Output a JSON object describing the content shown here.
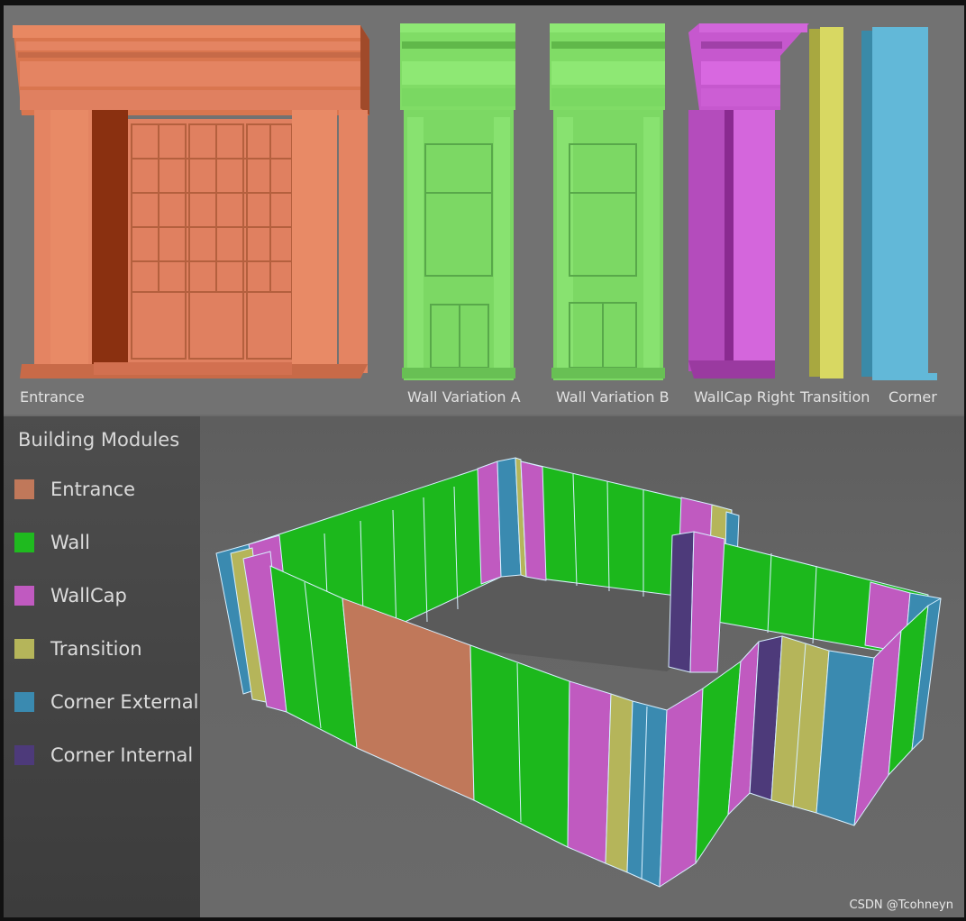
{
  "modules": {
    "entrance_label": "Entrance",
    "wall_a_label": "Wall Variation A",
    "wall_b_label": "Wall Variation B",
    "wallcap_label": "WallCap Right",
    "transition_label": "Transition",
    "corner_label": "Corner"
  },
  "legend": {
    "title": "Building Modules",
    "items": [
      {
        "label": "Entrance",
        "color": "#c0785a"
      },
      {
        "label": "Wall",
        "color": "#1fba1f"
      },
      {
        "label": "WallCap",
        "color": "#c05ac0"
      },
      {
        "label": "Transition",
        "color": "#b5b55a"
      },
      {
        "label": "Corner External",
        "color": "#3a8ab0"
      },
      {
        "label": "Corner Internal",
        "color": "#4d3a7a"
      }
    ]
  },
  "colors": {
    "entrance": "#e0825e",
    "wall": "#7ee06a",
    "wallcap": "#d060d8",
    "transition": "#d8d860",
    "corner": "#60b8d8"
  },
  "watermark": "CSDN @Tcohneyn"
}
